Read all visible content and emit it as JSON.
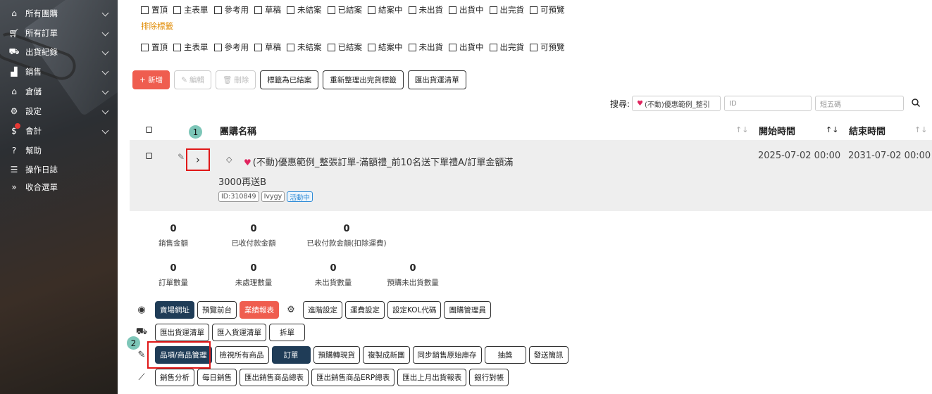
{
  "sidebar": {
    "items": [
      {
        "label": "所有團購",
        "icon": "home-icon",
        "chevron": true
      },
      {
        "label": "所有訂單",
        "icon": "cart-icon",
        "chevron": true
      },
      {
        "label": "出貨紀錄",
        "icon": "truck-icon",
        "chevron": true
      },
      {
        "label": "銷售",
        "icon": "bar-chart-icon",
        "chevron": true
      },
      {
        "label": "倉儲",
        "icon": "warehouse-icon",
        "chevron": true
      },
      {
        "label": "設定",
        "icon": "gear-icon",
        "chevron": true
      },
      {
        "label": "會計",
        "icon": "coins-icon",
        "chevron": true
      },
      {
        "label": "幫助",
        "icon": "question-icon",
        "chevron": false
      },
      {
        "label": "操作日誌",
        "icon": "list-icon",
        "chevron": false
      },
      {
        "label": "收合選單",
        "icon": "collapse-icon",
        "chevron": false
      }
    ]
  },
  "filters": {
    "include_options": [
      "置頂",
      "主表單",
      "參考用",
      "草稿",
      "未結案",
      "已結案",
      "結案中",
      "未出貨",
      "出貨中",
      "出完貨",
      "可預覽"
    ],
    "exclude_label": "排除標籤",
    "exclude_options": [
      "置頂",
      "主表單",
      "參考用",
      "草稿",
      "未結案",
      "已結案",
      "結案中",
      "未出貨",
      "出貨中",
      "出完貨",
      "可預覽"
    ]
  },
  "toolbar": {
    "add": "+ 新增",
    "edit": "編輯",
    "delete": "刪除",
    "mark_closed": "標籤為已結案",
    "reorganize": "重新整理出完貨標籤",
    "export_shipping": "匯出貨運清單"
  },
  "search": {
    "label": "搜尋:",
    "keyword_value": "(不動)優惠範例_整引",
    "id_placeholder": "ID",
    "shortcode_placeholder": "短五碼"
  },
  "table": {
    "headers": {
      "name": "團購名稱",
      "start": "開始時間",
      "end": "結束時間"
    },
    "rows": [
      {
        "title_line1": "(不動)優惠範例_整張訂單-滿額禮_前10名送下單禮A/訂單金額滿",
        "title_line2": "3000再送B",
        "tags": [
          "ID:310849",
          "Ivygy",
          "活動中"
        ],
        "start": "2025-07-02 00:00",
        "end": "2031-07-02 00:00"
      }
    ]
  },
  "markers": {
    "one": "1",
    "two": "2"
  },
  "stats": {
    "row1": [
      {
        "value": "0",
        "label": "銷售金額"
      },
      {
        "value": "0",
        "label": "已收付款金額"
      },
      {
        "value": "0",
        "label": "已收付款金額(扣除運費)"
      }
    ],
    "row2": [
      {
        "value": "0",
        "label": "訂單數量"
      },
      {
        "value": "0",
        "label": "未處理數量"
      },
      {
        "value": "0",
        "label": "未出貨數量"
      },
      {
        "value": "0",
        "label": "預購未出貨數量"
      }
    ]
  },
  "actions": {
    "row1": [
      "賣場網址",
      "預覽前台",
      "業績報表"
    ],
    "row1b": [
      "進階設定",
      "運費設定",
      "設定KOL代碼",
      "團購管理員"
    ],
    "row2": [
      "匯出貨運清單",
      "匯入貨運清單",
      "拆單"
    ],
    "row3": [
      "品項/商品管理",
      "檢視所有商品",
      "訂單",
      "預購轉現貨",
      "複製成新團",
      "同步銷售原始庫存",
      "抽獎",
      "發送簡訊"
    ],
    "row4": [
      "銷售分析",
      "每日銷售",
      "匯出銷售商品總表",
      "匯出銷售商品ERP總表",
      "匯出上月出貨報表",
      "銀行對帳"
    ]
  },
  "colors": {
    "accent_red": "#ef5d4f",
    "dark_navy": "#1f3c57",
    "exclude_orange": "#e08a00",
    "highlight_red": "#e01818"
  }
}
